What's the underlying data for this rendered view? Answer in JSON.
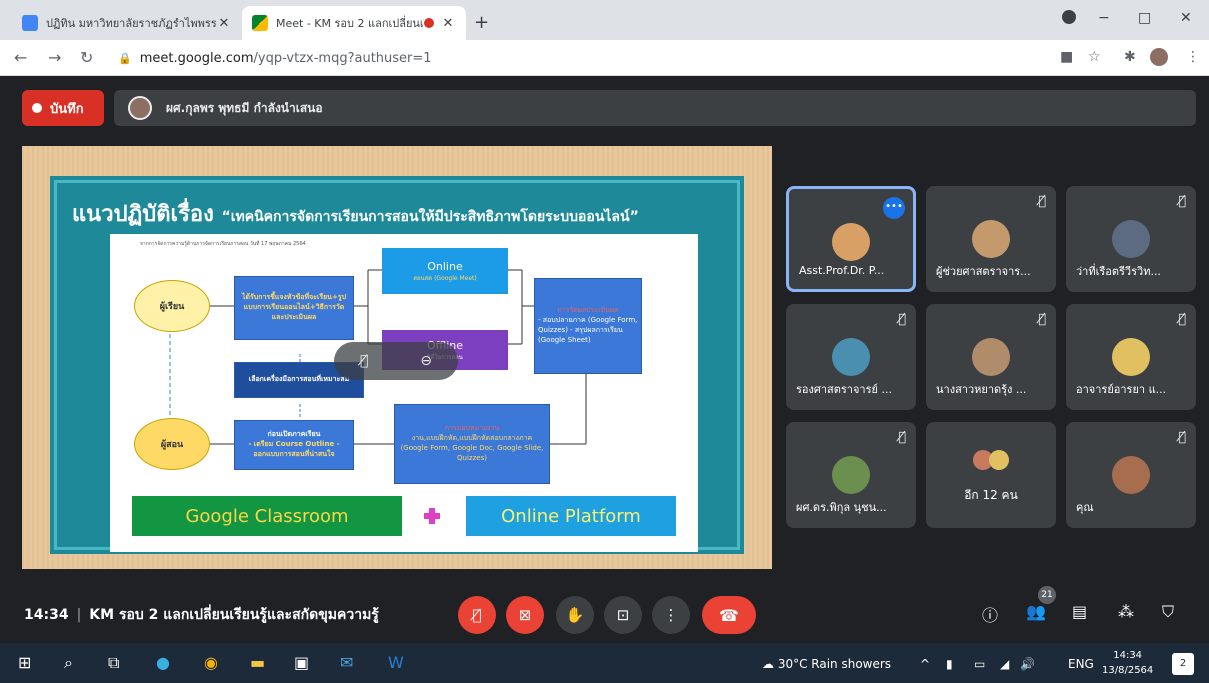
{
  "browser": {
    "tabs": [
      {
        "title": "ปฏิทิน มหาวิทยาลัยราชภัฏรำไพพรรณี",
        "active": false
      },
      {
        "title": "Meet - KM รอบ 2 แลกเปลี่ยนเรี",
        "active": true
      }
    ],
    "new_tab_label": "+",
    "window_controls": {
      "minimize": "−",
      "maximize": "□",
      "close": "✕"
    },
    "url_host": "meet.google.com",
    "url_path": "/yqp-vtzx-mqg?authuser=1"
  },
  "meet": {
    "record_label": "บันทึก",
    "presenter_notice": "ผศ.กุลพร พุทธมี กำลังนำเสนอ",
    "slide": {
      "title": "แนวปฏิบัติเรื่อง",
      "subtitle": "“เทคนิคการจัดการเรียนการสอนให้มีประสิทธิภาพโดยระบบออนไลน์”",
      "caption": "จากการจัดการความรู้ด้านการจัดการเรียนการสอน วันที่ 17 พฤษภาคม 2564",
      "learner": "ผู้เรียน",
      "teacher": "ผู้สอน",
      "box_learner": "ได้รับการชี้แจงหัวข้อที่จะเรียน+รูปแบบการเรียนออนไลน์+วิธีการวัดและประเมินผล",
      "box_choose": "เลือกเครื่องมือการสอนที่เหมาะสม",
      "box_teacher_title": "ก่อนเปิดภาคเรียน",
      "box_teacher_items": "- เตรียม Course Outline - ออกแบบการสอนที่น่าสนใจ",
      "online_title": "Online",
      "online_sub": "สอนสด (Google Meet)",
      "offline_title": "Offline",
      "offline_sub": "วิดีโอการสอน",
      "assess_title": "การวัดผลประเมินผล",
      "assess_body": "- สอบปลายภาค (Google Form, Quizzes) - สรุปผลการเรียน (Google Sheet)",
      "assign_title": "การมอบหมายงาน",
      "assign_body": "งาน,แบบฝึกหัด,แบบฝึกหัดสอบกลางภาค (Google Form, Google Doc, Google Slide, Quizzes)",
      "google_classroom": "Google Classroom",
      "online_platform": "Online Platform"
    },
    "participants": [
      {
        "name": "Asst.Prof.Dr. P...",
        "speaking": true,
        "muted": false,
        "color": "#d9a066"
      },
      {
        "name": "ผู้ช่วยศาสตราจาร...",
        "speaking": false,
        "muted": true,
        "color": "#c49a6c"
      },
      {
        "name": "ว่าที่เรือตรีวีรวิท...",
        "speaking": false,
        "muted": true,
        "color": "#5d6b82"
      },
      {
        "name": "รองศาสตราจารย์ ...",
        "speaking": false,
        "muted": true,
        "color": "#4a8fb0"
      },
      {
        "name": "นางสาวหยาดรุ้ง ...",
        "speaking": false,
        "muted": true,
        "color": "#b08c6a"
      },
      {
        "name": "อาจารย์อารยา แ...",
        "speaking": false,
        "muted": true,
        "color": "#e0c060"
      },
      {
        "name": "ผศ.ดร.พิกุล นุชน...",
        "speaking": false,
        "muted": true,
        "color": "#6a8f4e"
      },
      {
        "name": "คุณ",
        "speaking": false,
        "muted": true,
        "color": "#a66d4f"
      }
    ],
    "others_label": "อีก 12 คน",
    "time": "14:34",
    "meeting_title": "KM รอบ 2 แลกเปลี่ยนเรียนรู้และสกัดขุมความรู้",
    "people_count": "21"
  },
  "taskbar": {
    "weather": "30°C  Rain showers",
    "lang": "ENG",
    "clock_time": "14:34",
    "clock_date": "13/8/2564",
    "notif_count": "2"
  },
  "colors": {
    "meet_bg": "#202124",
    "tile_bg": "#3c4043",
    "accent": "#8ab4f8",
    "danger": "#ea4335"
  }
}
